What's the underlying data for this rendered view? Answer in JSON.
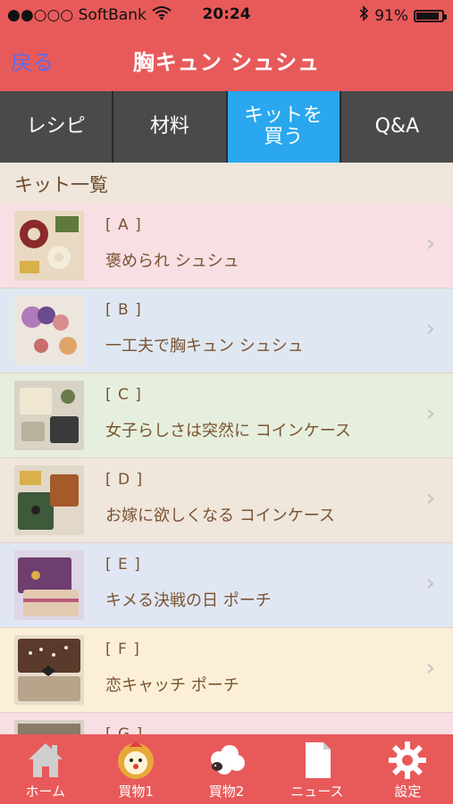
{
  "status": {
    "carrier": "●●○○○ SoftBank",
    "time": "20:24",
    "battery": "91%",
    "battery_level": 0.91
  },
  "nav": {
    "back": "戻る",
    "title": "胸キュン シュシュ"
  },
  "tabs": [
    {
      "label": "レシピ",
      "active": false
    },
    {
      "label": "材料",
      "active": false
    },
    {
      "label": "キットを買う",
      "active": true
    },
    {
      "label": "Q&A",
      "active": false
    }
  ],
  "section": {
    "title": "キット一覧"
  },
  "items": [
    {
      "code": "[ A ]",
      "name": "褒められ シュシュ",
      "bg": "#f7dfe3"
    },
    {
      "code": "[ B ]",
      "name": "一工夫で胸キュン シュシュ",
      "bg": "#dfe8f2"
    },
    {
      "code": "[ C ]",
      "name": "女子らしさは突然に コインケース",
      "bg": "#e6efdd"
    },
    {
      "code": "[ D ]",
      "name": "お嫁に欲しくなる コインケース",
      "bg": "#efe6dc"
    },
    {
      "code": "[ E ]",
      "name": "キメる決戦の日 ポーチ",
      "bg": "#e0e6f3"
    },
    {
      "code": "[ F ]",
      "name": "恋キャッチ ポーチ",
      "bg": "#fbf0d7"
    },
    {
      "code": "[ G ]",
      "name": "",
      "bg": "#f7dfe3"
    }
  ],
  "tabbar": [
    {
      "label": "ホーム",
      "icon": "home-icon"
    },
    {
      "label": "買物1",
      "icon": "lion-icon"
    },
    {
      "label": "買物2",
      "icon": "sheep-icon"
    },
    {
      "label": "ニュース",
      "icon": "document-icon"
    },
    {
      "label": "設定",
      "icon": "gear-icon"
    }
  ]
}
